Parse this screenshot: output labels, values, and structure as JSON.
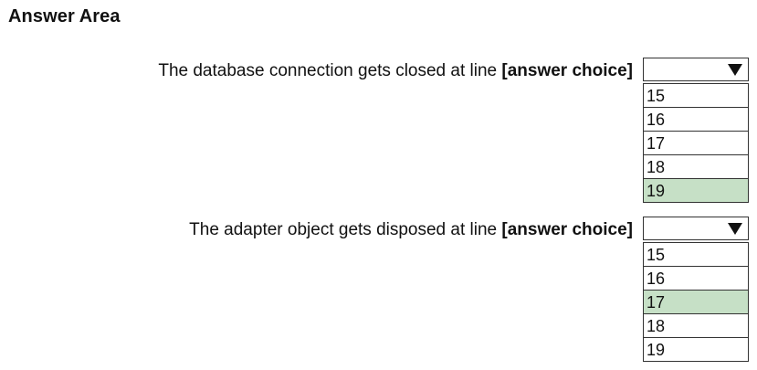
{
  "heading": "Answer Area",
  "questions": [
    {
      "prompt": "The database connection gets closed at line",
      "choice_label": "[answer choice]",
      "options": [
        "15",
        "16",
        "17",
        "18",
        "19"
      ],
      "selected": "19"
    },
    {
      "prompt": "The adapter object gets disposed at line",
      "choice_label": "[answer choice]",
      "options": [
        "15",
        "16",
        "17",
        "18",
        "19"
      ],
      "selected": "17"
    }
  ],
  "colors": {
    "selected_highlight": "#c6e0c6",
    "border": "#333333"
  },
  "icons": {
    "dropdown": "triangle-down-icon"
  }
}
